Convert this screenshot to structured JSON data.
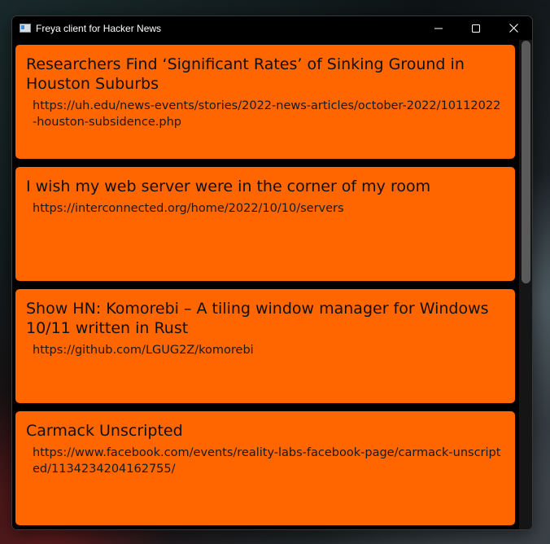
{
  "window": {
    "title": "Freya client for Hacker News"
  },
  "controls": {
    "minimize_icon": "minimize-icon",
    "maximize_icon": "maximize-icon",
    "close_icon": "close-icon"
  },
  "stories": [
    {
      "title": "Researchers Find ‘Significant Rates’ of Sinking Ground in Houston Suburbs",
      "url": "https://uh.edu/news-events/stories/2022-news-articles/october-2022/10112022-houston-subsidence.php"
    },
    {
      "title": "I wish my web server were in the corner of my room",
      "url": "https://interconnected.org/home/2022/10/10/servers"
    },
    {
      "title": "Show HN: Komorebi – A tiling window manager for Windows 10/11 written in Rust",
      "url": "https://github.com/LGUG2Z/komorebi"
    },
    {
      "title": "Carmack Unscripted",
      "url": "https://www.facebook.com/events/reality-labs-facebook-page/carmack-unscripted/1134234204162755/"
    }
  ],
  "colors": {
    "card_background": "#ff6600",
    "window_background": "#000000"
  }
}
